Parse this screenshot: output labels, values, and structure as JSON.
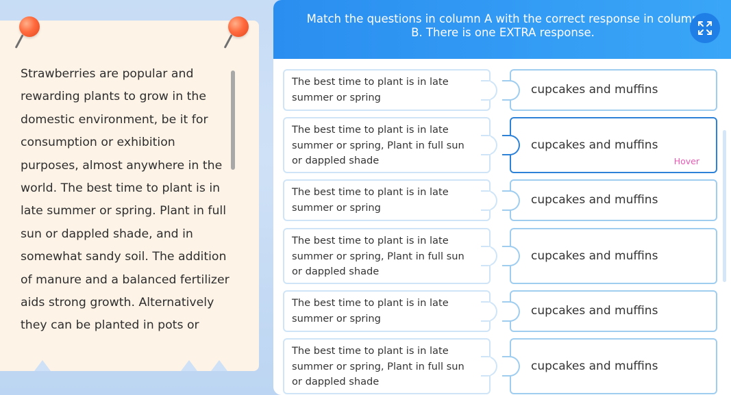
{
  "note": {
    "text": "Strawberries are popular and rewarding plants to grow in the domestic environment, be it for consumption or exhibition purposes, almost anywhere in the world. The best time to plant is in late summer or spring. Plant in full sun or dappled shade, and in somewhat sandy soil. The addition of manure and a balanced fertilizer aids strong growth. Alternatively they can be planted in pots or"
  },
  "header": {
    "instruction": "Match the questions in column A with the correct response in column B. There is one EXTRA response.",
    "expand_icon": "expand-arrows-icon"
  },
  "column_a": [
    {
      "text": "The best time to plant is in late summer or spring"
    },
    {
      "text": "The best time to plant is in late summer or spring, Plant in full sun or dappled shade"
    },
    {
      "text": "The best time to plant is in late summer or spring"
    },
    {
      "text": "The best time to plant is in late summer or spring, Plant in full sun or dappled shade"
    },
    {
      "text": "The best time to plant is in late summer or spring"
    },
    {
      "text": "The best time to plant is in late summer or spring, Plant in full sun or dappled shade"
    }
  ],
  "column_b": [
    {
      "text": "cupcakes and muffins"
    },
    {
      "text": "cupcakes and muffins",
      "state_label": "Hover"
    },
    {
      "text": "cupcakes and muffins"
    },
    {
      "text": "cupcakes and muffins"
    },
    {
      "text": "cupcakes and muffins"
    },
    {
      "text": "cupcakes and muffins"
    }
  ],
  "colors": {
    "header": "#2a8ef0",
    "card_border": "#9fcdf0",
    "hover_border": "#2d82d8",
    "hover_label": "#e85ab5",
    "note_bg": "#fdf3e7",
    "pin": "#ff6a3d"
  }
}
